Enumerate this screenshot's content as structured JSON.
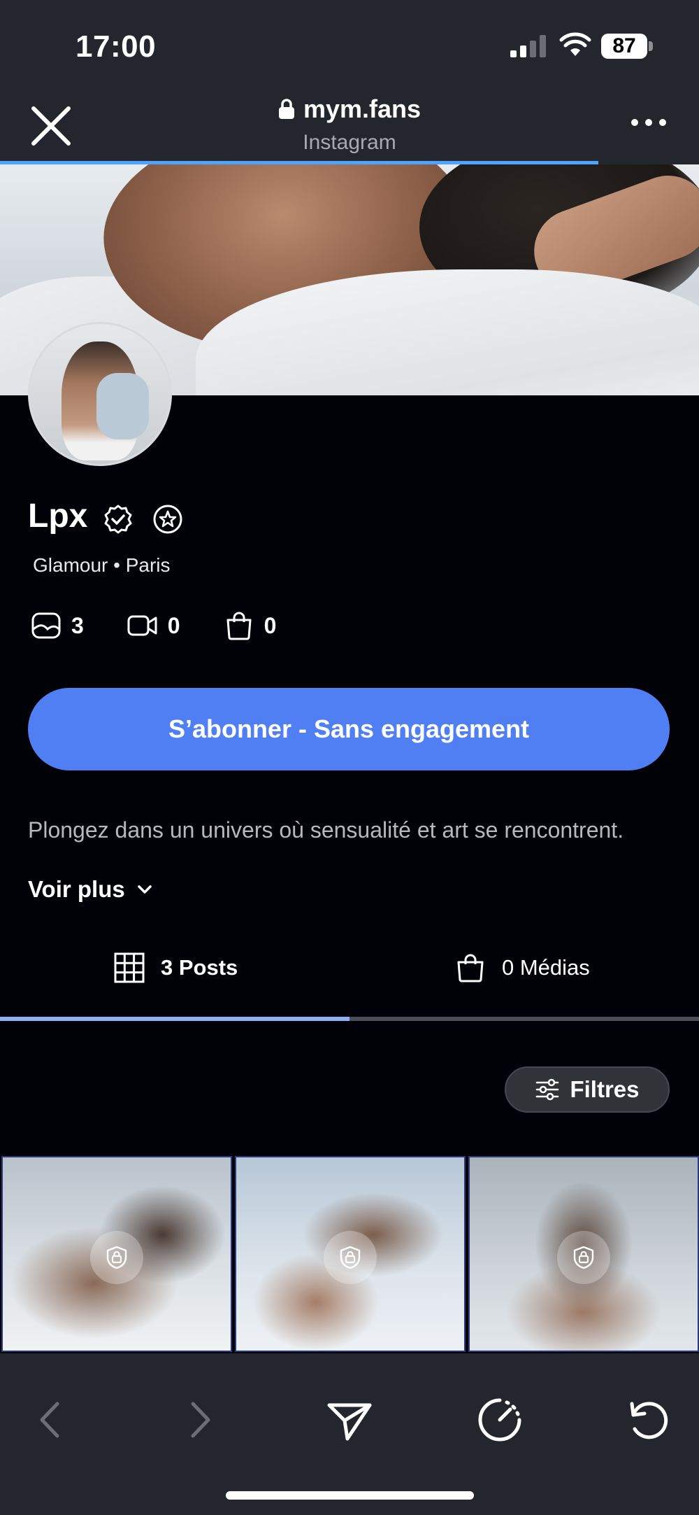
{
  "status_bar": {
    "time": "17:00",
    "battery": "87"
  },
  "browser": {
    "url": "mym.fans",
    "subtitle": "Instagram"
  },
  "profile": {
    "name": "Lpx",
    "category": "Glamour • Paris",
    "stats": {
      "photos": "3",
      "videos": "0",
      "medias": "0"
    },
    "subscribe_label": "S’abonner - Sans engagement",
    "bio": "Plongez dans un univers où sensualité et art se rencontrent.",
    "see_more": "Voir plus"
  },
  "tabs": [
    {
      "label": "3 Posts",
      "active": true
    },
    {
      "label": "0 Médias",
      "active": false
    }
  ],
  "filters_label": "Filtres",
  "colors": {
    "accent": "#4f7ff3",
    "background": "#000207",
    "chrome": "#23262d"
  }
}
